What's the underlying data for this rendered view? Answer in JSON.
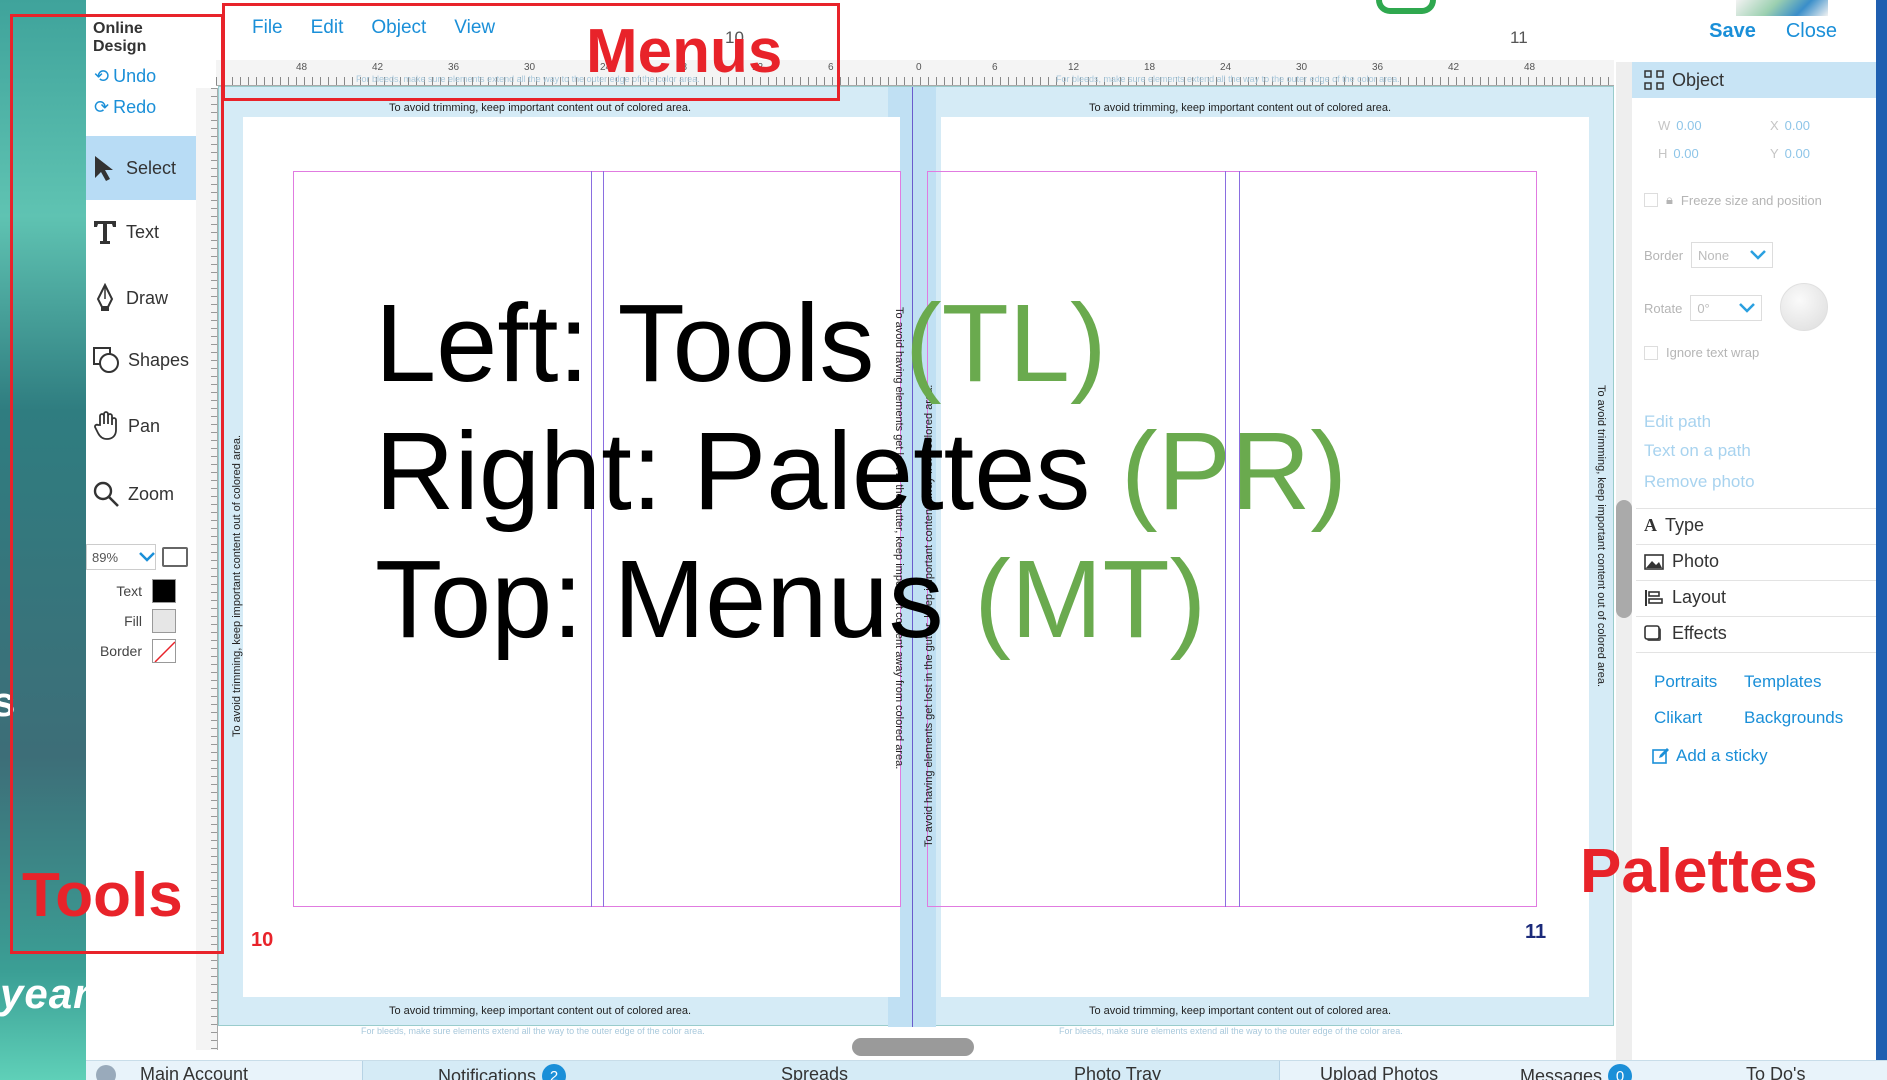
{
  "app": {
    "title": "Online Design",
    "undo_label": "Undo",
    "redo_label": "Redo",
    "save_label": "Save",
    "close_label": "Close"
  },
  "menus": [
    "File",
    "Edit",
    "Object",
    "View"
  ],
  "tools": [
    {
      "label": "Select",
      "icon": "arrow-cursor-icon",
      "active": true
    },
    {
      "label": "Text",
      "icon": "text-t-icon",
      "active": false
    },
    {
      "label": "Draw",
      "icon": "pen-nib-icon",
      "active": false
    },
    {
      "label": "Shapes",
      "icon": "shapes-icon",
      "active": false
    },
    {
      "label": "Pan",
      "icon": "hand-icon",
      "active": false
    },
    {
      "label": "Zoom",
      "icon": "magnifier-icon",
      "active": false
    }
  ],
  "zoom": {
    "value": "89%"
  },
  "colors": {
    "text_label": "Text",
    "fill_label": "Fill",
    "border_label": "Border",
    "text_color": "#000000",
    "fill_color": "#e6e6e6",
    "accent": "#1a8fd8",
    "annotation_red": "#e8232a",
    "caption_green": "#6aaa4e"
  },
  "rulers": {
    "top_labels": [
      "48",
      "42",
      "36",
      "30",
      "24",
      "18",
      "12",
      "6",
      "0",
      "6",
      "12",
      "18",
      "24",
      "30",
      "36",
      "42",
      "48"
    ],
    "page_labels": [
      "10",
      "11"
    ]
  },
  "canvas": {
    "safe_note": "To avoid trimming, keep important content out of colored area.",
    "bleed_note": "For bleeds, make sure elements extend all the way to the outer edge of the color area.",
    "gutter_note": "To avoid having elements get lost in the gutter, keep important content away from colored area.",
    "left_page_number": "10",
    "right_page_number": "11"
  },
  "caption": {
    "line1_main": "Left: Tools ",
    "line1_code": "(TL)",
    "line2_main": "Right: Palettes ",
    "line2_code": "(PR)",
    "line3_main": "Top: Menus ",
    "line3_code": "(MT)"
  },
  "annotations": {
    "menus": "Menus",
    "tools": "Tools",
    "palettes": "Palettes"
  },
  "palette": {
    "header": "Object",
    "w_label": "W",
    "w_value": "0.00",
    "h_label": "H",
    "h_value": "0.00",
    "x_label": "X",
    "x_value": "0.00",
    "y_label": "Y",
    "y_value": "0.00",
    "freeze_label": "Freeze size and position",
    "border_label": "Border",
    "border_value": "None",
    "rotate_label": "Rotate",
    "rotate_value": "0°",
    "ignore_wrap_label": "Ignore text wrap",
    "links": [
      "Edit path",
      "Text on a path",
      "Remove photo"
    ],
    "sections": [
      "Type",
      "Photo",
      "Layout",
      "Effects"
    ],
    "resources": [
      "Portraits",
      "Templates",
      "Clikart",
      "Backgrounds"
    ],
    "sticky_label": "Add a sticky"
  },
  "bottom_bar": {
    "main_account": "Main Account",
    "notifications": "Notifications",
    "notifications_count": "2",
    "spreads": "Spreads",
    "photo_tray": "Photo Tray",
    "upload_photos": "Upload Photos",
    "messages": "Messages",
    "messages_count": "0",
    "todos": "To Do's"
  },
  "background": {
    "strip_text": "year",
    "strip_letter": "s"
  }
}
